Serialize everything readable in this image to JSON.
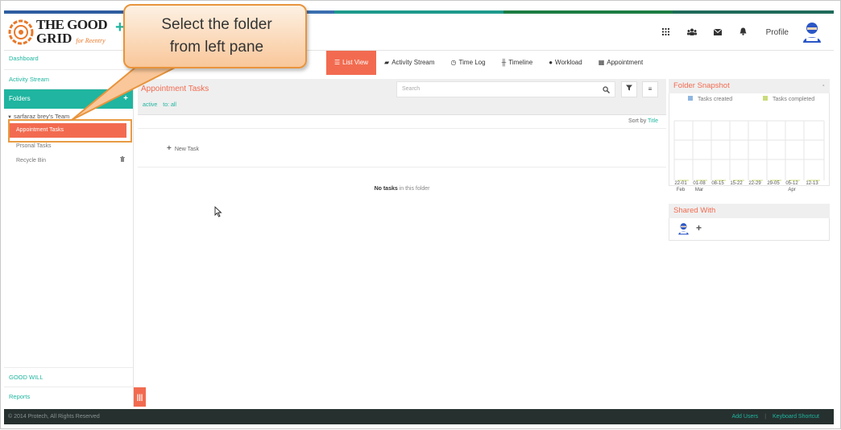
{
  "colors": {
    "accent": "#1fb5a0",
    "orange": "#f26b50",
    "topbar": [
      "#2d5d9f",
      "#3a6fb0",
      "#1e9a8c",
      "#1b7d43",
      "#1f6b5a"
    ]
  },
  "brand": {
    "line1": "THE GOOD",
    "line2": "GRID",
    "tagline": "for Reentry"
  },
  "header": {
    "icons": [
      "apps-grid-icon",
      "users-icon",
      "mail-icon",
      "bell-icon"
    ],
    "profile_label": "Profile"
  },
  "sidebar": {
    "dashboard": "Dashboard",
    "activity_stream": "Activity Stream",
    "folders": "Folders",
    "team_name": "sarfaraz brey's Team",
    "active_folder": "Appointment Tasks",
    "personal_tasks": "Prsonal Tasks",
    "recycle_bin": "Recycle Bin",
    "good_will": "GOOD WILL",
    "reports": "Reports"
  },
  "tabs": [
    {
      "label": "List View",
      "icon": "list-icon"
    },
    {
      "label": "Activity Stream",
      "icon": "comment-icon"
    },
    {
      "label": "Time Log",
      "icon": "clock-icon"
    },
    {
      "label": "Timeline",
      "icon": "timeline-icon"
    },
    {
      "label": "Workload",
      "icon": "user-icon"
    },
    {
      "label": "Appointment",
      "icon": "calendar-icon"
    }
  ],
  "main": {
    "title": "Appointment Tasks",
    "filter_active": "active",
    "filter_to": "to: all",
    "search_placeholder": "Search",
    "sort_by_label": "Sort by",
    "sort_by_value": "Title",
    "new_task": "New Task",
    "no_tasks_bold": "No tasks",
    "no_tasks_rest": " in this folder"
  },
  "snapshot": {
    "title": "Folder Snapshot",
    "legend_created": "Tasks created",
    "legend_completed": "Tasks completed",
    "created_color": "#8fb6e0",
    "completed_color": "#c9dc7a",
    "x_labels": [
      "22-01",
      "01-08",
      "08-15",
      "15-22",
      "22-29",
      "29-05",
      "05-12",
      "12-13"
    ],
    "x_months": [
      "Feb",
      "Mar",
      "Apr"
    ]
  },
  "shared": {
    "title": "Shared With"
  },
  "callout": {
    "line1": "Select the folder",
    "line2": "from left pane"
  },
  "footer": {
    "copyright": "© 2014 Protech, All Rights Reserved",
    "add_users": "Add Users",
    "separator": "|",
    "keyboard_shortcut": "Keyboard Shortcut"
  }
}
